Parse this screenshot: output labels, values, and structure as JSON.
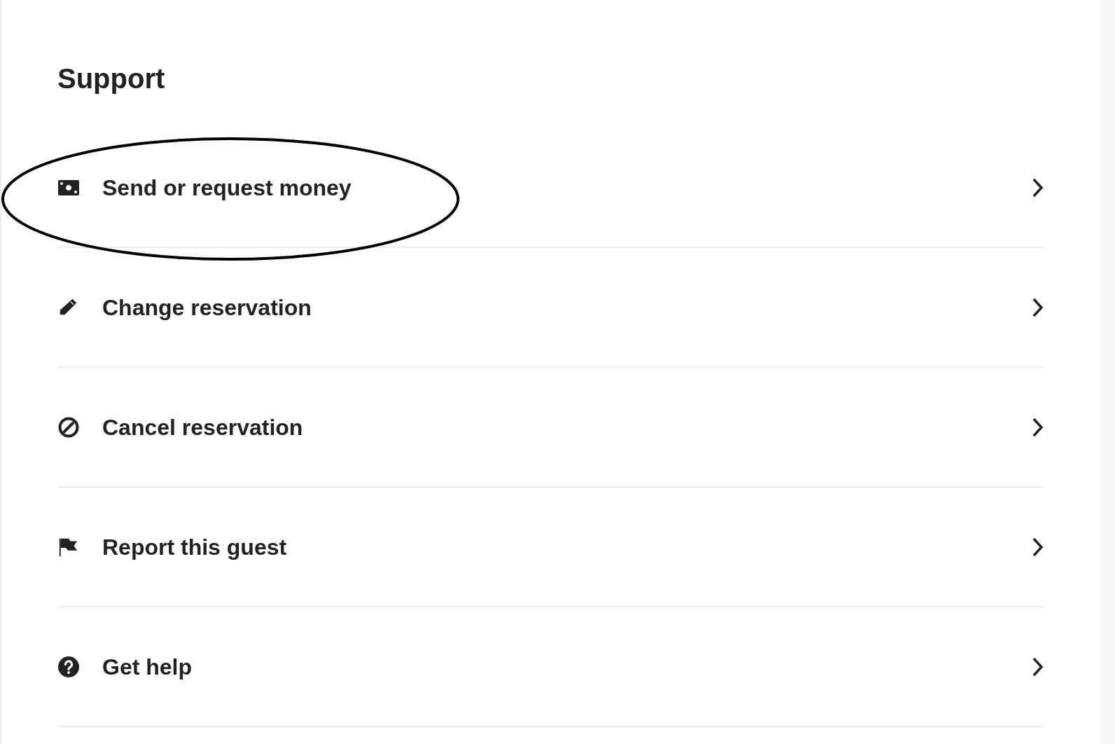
{
  "title": "Support",
  "items": [
    {
      "label": "Send or request money",
      "kind": "money",
      "highlighted": true
    },
    {
      "label": "Change reservation",
      "kind": "edit",
      "highlighted": false
    },
    {
      "label": "Cancel reservation",
      "kind": "cancel",
      "highlighted": false
    },
    {
      "label": "Report this guest",
      "kind": "report",
      "highlighted": false
    },
    {
      "label": "Get help",
      "kind": "help",
      "highlighted": false
    }
  ]
}
